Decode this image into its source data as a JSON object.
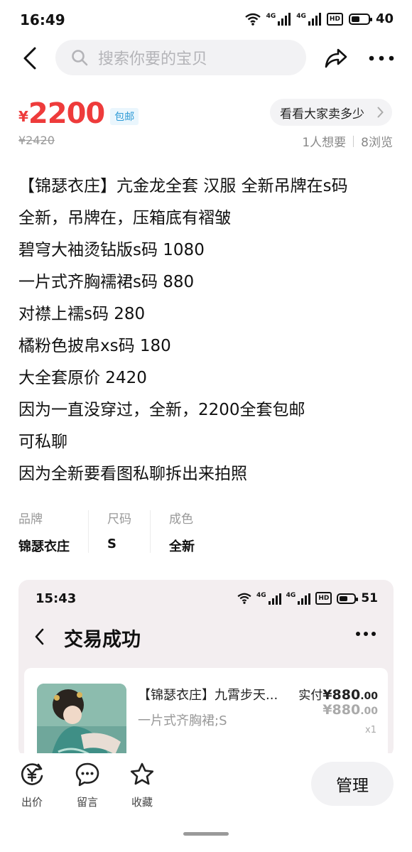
{
  "status_bar": {
    "time": "16:49",
    "network_a": "4G",
    "network_b": "4G",
    "hd": "HD",
    "battery": "40"
  },
  "search": {
    "placeholder": "搜索你要的宝贝"
  },
  "price": {
    "symbol": "¥",
    "value": "2200",
    "free_shipping": "包邮",
    "original": "¥2420"
  },
  "compare_button": "看看大家卖多少",
  "stats": {
    "wants": "1人想要",
    "views": "8浏览"
  },
  "description": [
    "【锦瑟衣庄】亢金龙全套 汉服 全新吊牌在s码",
    "全新，吊牌在，压箱底有褶皱",
    "碧穹大袖烫钻版s码 1080",
    "一片式齐胸襦裙s码 880",
    "对襟上襦s码 280",
    "橘粉色披帛xs码 180",
    "大全套原价 2420",
    "因为一直没穿过，全新，2200全套包邮",
    "可私聊",
    "因为全新要看图私聊拆出来拍照"
  ],
  "attributes": [
    {
      "label": "品牌",
      "value": "锦瑟衣庄"
    },
    {
      "label": "尺码",
      "value": "S"
    },
    {
      "label": "成色",
      "value": "全新"
    }
  ],
  "screenshot": {
    "time": "15:43",
    "network_a": "4G",
    "network_b": "4G",
    "hd": "HD",
    "battery": "51",
    "title": "交易成功",
    "order": {
      "title": "【锦瑟衣庄】九霄步天...",
      "sku": "一片式齐胸裙;S",
      "paid_label": "实付",
      "paid_symbol": "¥",
      "paid_int": "880",
      "paid_dec": ".00",
      "orig_symbol": "¥",
      "orig_int": "880",
      "orig_dec": ".00",
      "qty": "x1"
    }
  },
  "bottom_bar": {
    "bid": "出价",
    "comment": "留言",
    "favorite": "收藏",
    "manage": "管理"
  },
  "colors": {
    "price": "#ee3b3b",
    "shipping_badge": "#2f9bd6"
  }
}
